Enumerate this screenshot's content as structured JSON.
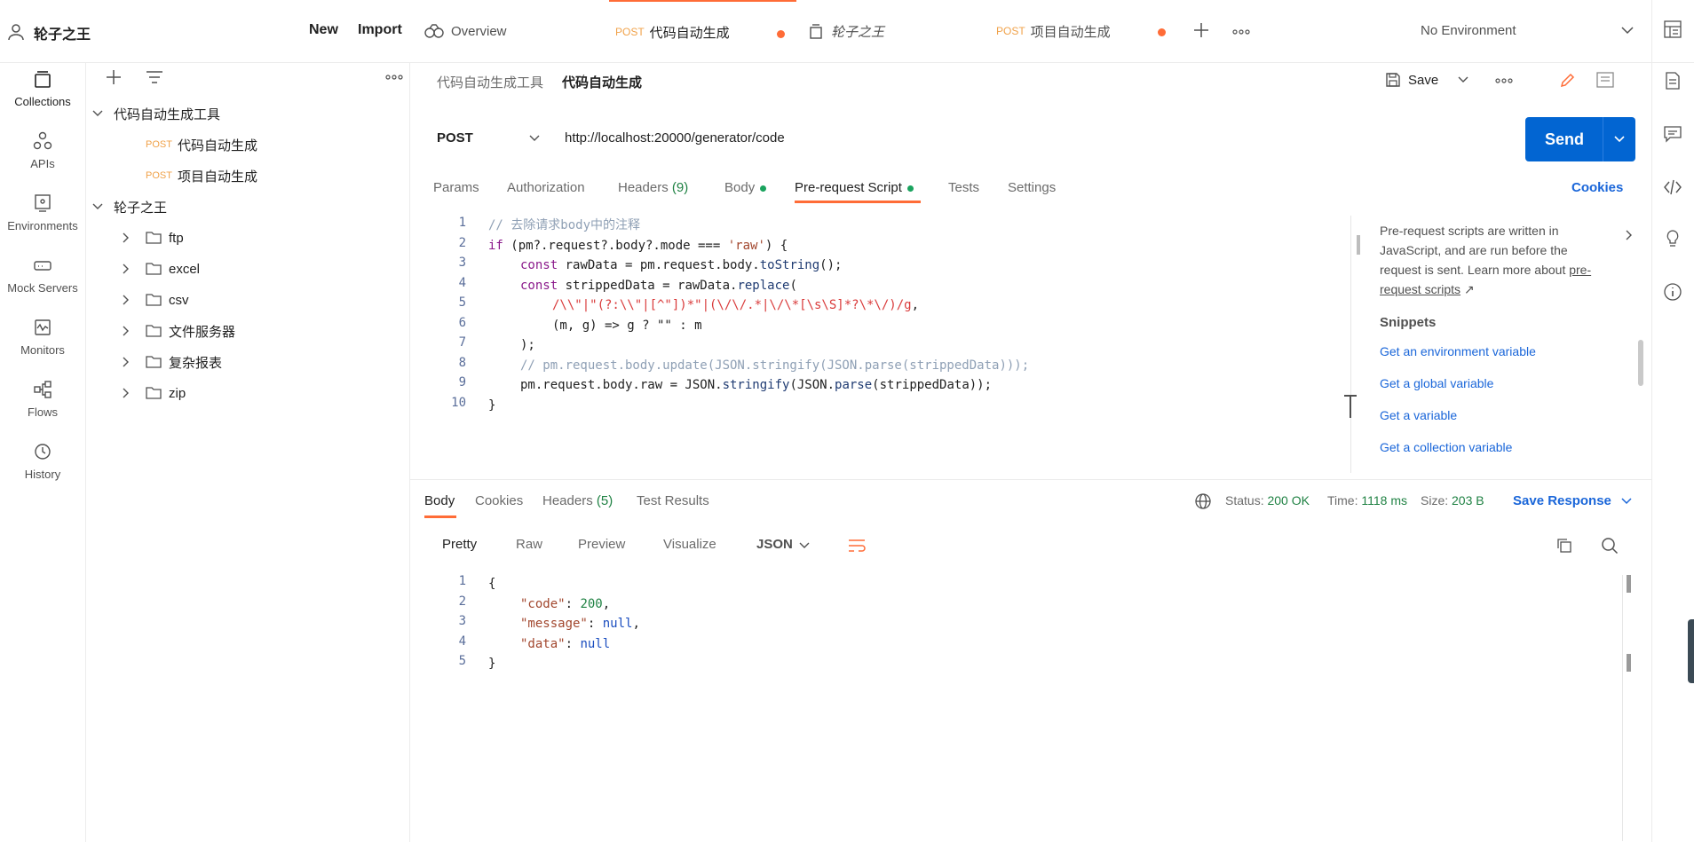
{
  "topbar": {
    "workspace": "轮子之王",
    "new_label": "New",
    "import_label": "Import",
    "tabs": [
      {
        "label": "Overview",
        "method": ""
      },
      {
        "label": "代码自动生成",
        "method": "POST"
      },
      {
        "label": "轮子之王",
        "method": ""
      },
      {
        "label": "项目自动生成",
        "method": "POST"
      }
    ],
    "environment": "No Environment"
  },
  "rail": {
    "items": [
      {
        "label": "Collections",
        "icon": "collections-icon"
      },
      {
        "label": "APIs",
        "icon": "apis-icon"
      },
      {
        "label": "Environments",
        "icon": "environments-icon"
      },
      {
        "label": "Mock Servers",
        "icon": "mock-servers-icon"
      },
      {
        "label": "Monitors",
        "icon": "monitors-icon"
      },
      {
        "label": "Flows",
        "icon": "flows-icon"
      },
      {
        "label": "History",
        "icon": "history-icon"
      }
    ]
  },
  "sidebar": {
    "collections": [
      {
        "name": "代码自动生成工具",
        "requests": [
          {
            "method": "POST",
            "name": "代码自动生成"
          },
          {
            "method": "POST",
            "name": "项目自动生成"
          }
        ]
      },
      {
        "name": "轮子之王",
        "folders": [
          "ftp",
          "excel",
          "csv",
          "文件服务器",
          "复杂报表",
          "zip"
        ]
      }
    ]
  },
  "request": {
    "breadcrumb_parent": "代码自动生成工具",
    "breadcrumb_sep": "/",
    "breadcrumb_current": "代码自动生成",
    "save_label": "Save",
    "method": "POST",
    "url": "http://localhost:20000/generator/code",
    "send_label": "Send",
    "tabs": {
      "params": "Params",
      "authorization": "Authorization",
      "headers": "Headers",
      "headers_count": "(9)",
      "body": "Body",
      "prerequest": "Pre-request Script",
      "tests": "Tests",
      "settings": "Settings"
    },
    "cookies_label": "Cookies"
  },
  "script": {
    "line_numbers": [
      "1",
      "2",
      "3",
      "4",
      "5",
      "6",
      "7",
      "8",
      "9",
      "10"
    ],
    "comment1": "// 去除请求body中的注释",
    "l2_if": "if",
    "l2_rest": " (pm?.request?.body?.mode === ",
    "l2_str": "'raw'",
    "l2_end": ") {",
    "l3_const": "const",
    "l3_rest": " rawData = pm.request.body.",
    "l3_fn": "toString",
    "l3_end": "();",
    "l4_const": "const",
    "l4_rest": " strippedData = rawData.",
    "l4_fn": "replace",
    "l4_end": "(",
    "l5_regex": "/\\\\\"|\"(?:\\\\\"|[^\"])*\"|(\\/\\/.*|\\/\\*[\\s\\S]*?\\*\\/)/g",
    "l5_end": ",",
    "l6": "(m, g) => g ? \"\" : m",
    "l7": ");",
    "l8": "// pm.request.body.update(JSON.stringify(JSON.parse(strippedData)));",
    "l9_start": "pm.request.body.raw = JSON.",
    "l9_fn1": "stringify",
    "l9_mid": "(JSON.",
    "l9_fn2": "parse",
    "l9_end": "(strippedData));",
    "l10": "}"
  },
  "snippets": {
    "intro": "Pre-request scripts are written in JavaScript, and are run before the request is sent. Learn more about",
    "intro_link": "pre-request scripts",
    "title": "Snippets",
    "items": [
      "Get an environment variable",
      "Get a global variable",
      "Get a variable",
      "Get a collection variable"
    ]
  },
  "response": {
    "tabs": {
      "body": "Body",
      "cookies": "Cookies",
      "headers": "Headers",
      "headers_count": "(5)",
      "tests": "Test Results"
    },
    "status_label": "Status:",
    "status_value": "200 OK",
    "time_label": "Time:",
    "time_value": "1118 ms",
    "size_label": "Size:",
    "size_value": "203 B",
    "save_response": "Save Response",
    "views": {
      "pretty": "Pretty",
      "raw": "Raw",
      "preview": "Preview",
      "visualize": "Visualize"
    },
    "format": "JSON",
    "line_numbers": [
      "1",
      "2",
      "3",
      "4",
      "5"
    ],
    "json": {
      "open": "{",
      "k_code": "\"code\"",
      "v_code": "200",
      "k_message": "\"message\"",
      "v_message": "null",
      "k_data": "\"data\"",
      "v_data": "null",
      "close": "}"
    }
  },
  "colors": {
    "accent": "#ff6c37",
    "primary": "#0265d2",
    "success": "#208244"
  }
}
